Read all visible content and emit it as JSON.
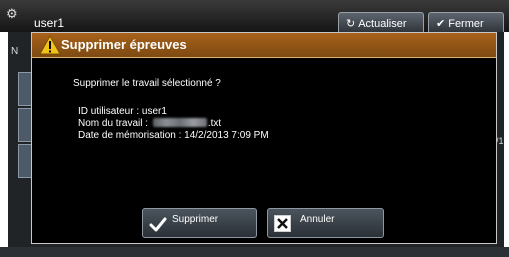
{
  "background": {
    "user_label": "user1",
    "refresh_label": "Actualiser",
    "close_label": "Fermer",
    "left_letter": "N",
    "right_fragment": "/1"
  },
  "dialog": {
    "title": "Supprimer épreuves",
    "message": "Supprimer le travail sélectionné ?",
    "user_id_line": "ID utilisateur : user1",
    "job_name_label": "Nom du travail :",
    "job_name_suffix": ".txt",
    "stored_date_line": "Date de mémorisation : 14/2/2013 7:09 PM",
    "confirm_label": "Supprimer",
    "cancel_label": "Annuler"
  },
  "colors": {
    "title_bar": "#9a5a17",
    "dialog_bg": "#000000",
    "button_bg": "#3a424a",
    "check_green": "#ffffff"
  },
  "icons": {
    "title": "warning-icon",
    "confirm": "check-icon",
    "cancel": "x-box-icon"
  }
}
